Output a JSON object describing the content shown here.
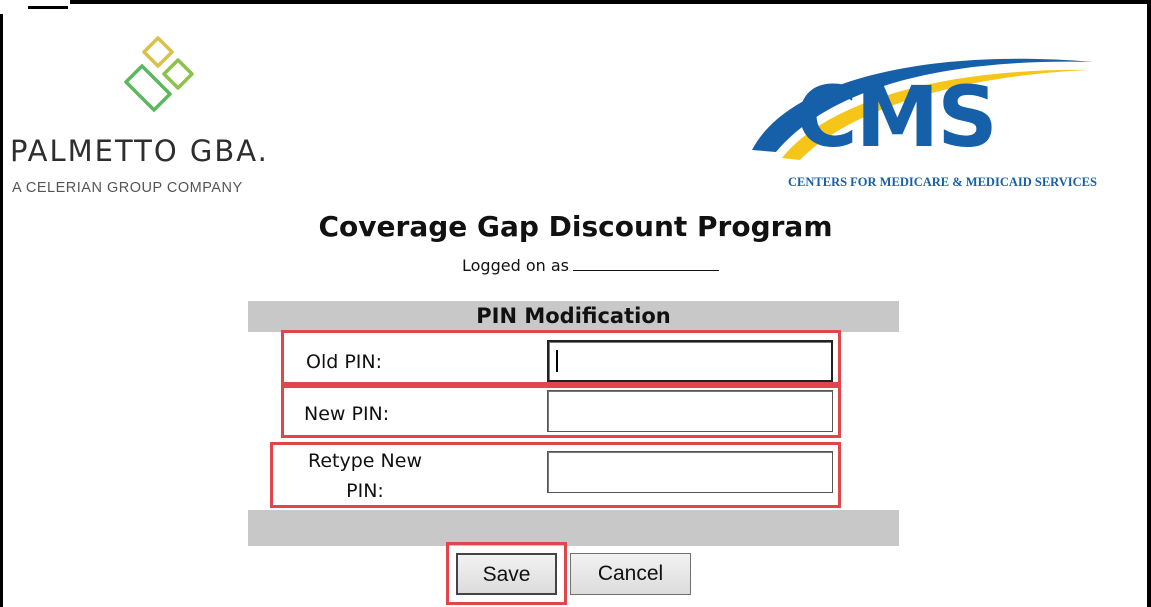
{
  "branding": {
    "left_logo_name": "PALMETTO GBA.",
    "left_logo_sub": "A CELERIAN GROUP COMPANY",
    "right_logo_name": "CMS",
    "right_logo_sub": "CENTERS FOR MEDICARE & MEDICAID SERVICES"
  },
  "header": {
    "title": "Coverage Gap Discount Program",
    "logged_on_label": "Logged on as"
  },
  "form": {
    "section_title": "PIN Modification",
    "old_pin_label": "Old PIN:",
    "old_pin_value": "",
    "new_pin_label": "New PIN:",
    "new_pin_value": "",
    "retype_pin_label_line1": "Retype New",
    "retype_pin_label_line2": "PIN:",
    "retype_pin_value": ""
  },
  "buttons": {
    "save": "Save",
    "cancel": "Cancel"
  },
  "colors": {
    "highlight": "#e0464b",
    "panel_gray": "#c8c8c8",
    "cms_blue": "#1560a8",
    "palmetto_green": "#6cbf3f",
    "palmetto_yellow": "#d8c24a"
  }
}
